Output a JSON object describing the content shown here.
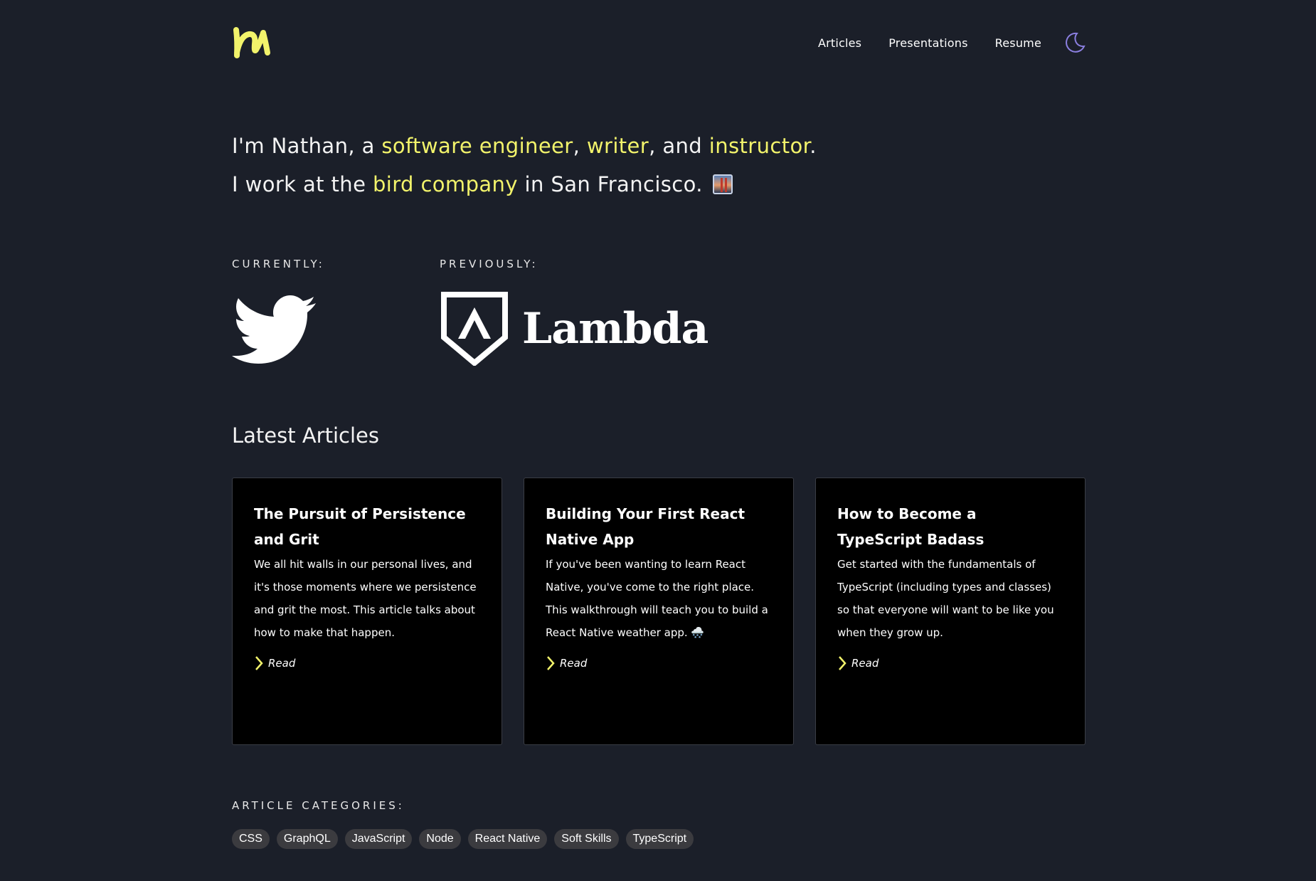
{
  "header": {
    "nav": [
      "Articles",
      "Presentations",
      "Resume"
    ],
    "theme_toggle_icon": "moon-icon"
  },
  "intro": {
    "line1": {
      "pre": "I'm Nathan, a ",
      "role1": "software engineer",
      "sep1": ", ",
      "role2": "writer",
      "sep2": ", and ",
      "role3": "instructor",
      "end": "."
    },
    "line2": {
      "pre": "I work at the ",
      "company": "bird company",
      "post": " in San Francisco. "
    }
  },
  "employment": {
    "current_label": "CURRENTLY:",
    "previous_label": "PREVIOUSLY:",
    "previous_name": "Lambda"
  },
  "articles": {
    "title": "Latest Articles",
    "items": [
      {
        "title": "The Pursuit of Persistence and Grit",
        "description": "We all hit walls in our personal lives, and it's those moments where we persistence and grit the most. This article talks about how to make that happen.",
        "cta": "Read"
      },
      {
        "title": "Building Your First React Native App",
        "description": "If you've been wanting to learn React Native, you've come to the right place. This walkthrough will teach you to build a React Native weather app. 🌨️",
        "cta": "Read"
      },
      {
        "title": "How to Become a TypeScript Badass",
        "description": "Get started with the fundamentals of TypeScript (including types and classes) so that everyone will want to be like you when they grow up.",
        "cta": "Read"
      }
    ]
  },
  "categories": {
    "label": "ARTICLE CATEGORIES:",
    "tags": [
      "CSS",
      "GraphQL",
      "JavaScript",
      "Node",
      "React Native",
      "Soft Skills",
      "TypeScript"
    ]
  },
  "colors": {
    "background": "#1b1f29",
    "accent": "#f2f36b",
    "moon": "#8b7fe0",
    "card": "#000000",
    "tag": "#3b3b3f"
  }
}
